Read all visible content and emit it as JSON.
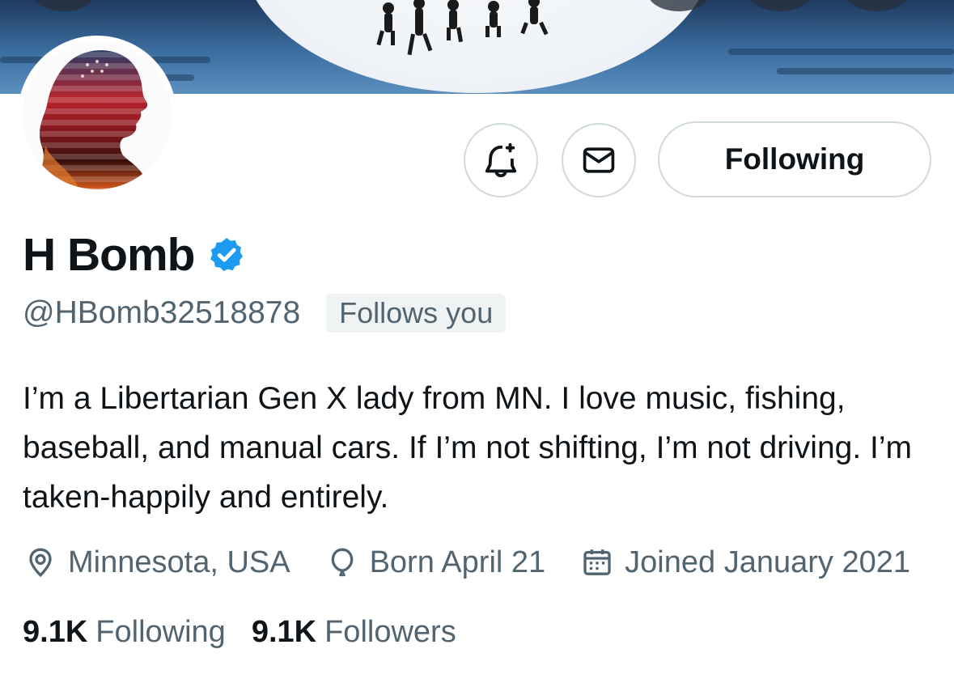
{
  "profile": {
    "display_name": "H Bomb",
    "verified": true,
    "handle": "@HBomb32518878",
    "follows_you_label": "Follows you",
    "bio": "I’m a Libertarian Gen X lady from MN. I love music, fishing, baseball, and manual cars. If I’m not shifting, I’m not driving. I’m taken-happily and entirely."
  },
  "actions": {
    "notifications_icon": "bell-plus-icon",
    "message_icon": "envelope-icon",
    "follow_label": "Following"
  },
  "meta": {
    "location": "Minnesota, USA",
    "birthday": "Born April 21",
    "joined": "Joined January 2021"
  },
  "stats": {
    "following_count": "9.1K",
    "following_label": "Following",
    "followers_count": "9.1K",
    "followers_label": "Followers"
  },
  "colors": {
    "verified_blue": "#1d9bf0",
    "secondary_text": "#536471",
    "border": "#cfd9de",
    "badge_bg": "#eff3f4"
  }
}
